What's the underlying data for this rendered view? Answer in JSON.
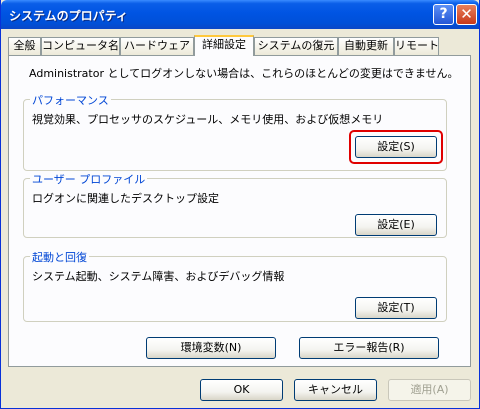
{
  "window": {
    "title": "システムのプロパティ"
  },
  "titlebar_buttons": {
    "help": "?",
    "close": "✕"
  },
  "tabs": [
    {
      "label": "全般"
    },
    {
      "label": "コンピュータ名"
    },
    {
      "label": "ハードウェア"
    },
    {
      "label": "詳細設定"
    },
    {
      "label": "システムの復元"
    },
    {
      "label": "自動更新"
    },
    {
      "label": "リモート"
    }
  ],
  "active_tab": "詳細設定",
  "notice": "Administrator としてログオンしない場合は、これらのほとんどの変更はできません。",
  "groups": {
    "performance": {
      "label": "パフォーマンス",
      "description": "視覚効果、プロセッサのスケジュール、メモリ使用、および仮想メモリ",
      "button": "設定(S)"
    },
    "user_profile": {
      "label": "ユーザー プロファイル",
      "description": "ログオンに関連したデスクトップ設定",
      "button": "設定(E)"
    },
    "startup_recovery": {
      "label": "起動と回復",
      "description": "システム起動、システム障害、およびデバッグ情報",
      "button": "設定(T)"
    }
  },
  "env_vars_button": "環境変数(N)",
  "error_report_button": "エラー報告(R)",
  "dialog_buttons": {
    "ok": "OK",
    "cancel": "キャンセル",
    "apply": "適用(A)"
  },
  "colors": {
    "highlight": "#e00000",
    "title_bar": "#0054e3",
    "group_label": "#0046d5"
  }
}
